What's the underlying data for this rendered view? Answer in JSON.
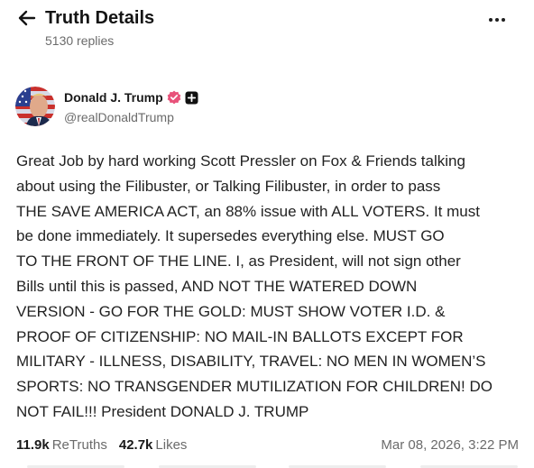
{
  "header": {
    "title": "Truth Details",
    "replies": "5130 replies"
  },
  "post": {
    "author_name": "Donald J. Trump",
    "handle": "@realDonaldTrump",
    "body": "Great Job by hard working Scott Pressler on Fox & Friends talking\nabout using the Filibuster, or Talking Filibuster, in order to pass\nTHE SAVE AMERICA ACT, an 88% issue with ALL VOTERS. It must\nbe done immediately. It supersedes everything else. MUST GO\nTO THE FRONT OF THE LINE. I, as President, will not sign other\nBills until this is passed, AND NOT THE WATERED DOWN\nVERSION - GO FOR THE GOLD: MUST SHOW VOTER I.D. &\nPROOF OF CITIZENSHIP: NO MAIL-IN BALLOTS EXCEPT FOR\nMILITARY - ILLNESS, DISABILITY, TRAVEL: NO MEN IN WOMEN’S\nSPORTS: NO TRANSGENDER MUTILIZATION FOR CHILDREN! DO\nNOT FAIL!!! President DONALD J. TRUMP",
    "retruths_count": "11.9k",
    "retruths_label": "ReTruths",
    "likes_count": "42.7k",
    "likes_label": "Likes",
    "timestamp": "Mar 08, 2026, 3:22 PM"
  },
  "icons": {
    "back": "arrow-left-icon",
    "more": "more-horizontal-icon",
    "verified": "verified-badge-icon",
    "plus": "plus-square-icon"
  },
  "colors": {
    "verified_badge": "#e8527a",
    "muted_text": "#6b6b6b"
  }
}
